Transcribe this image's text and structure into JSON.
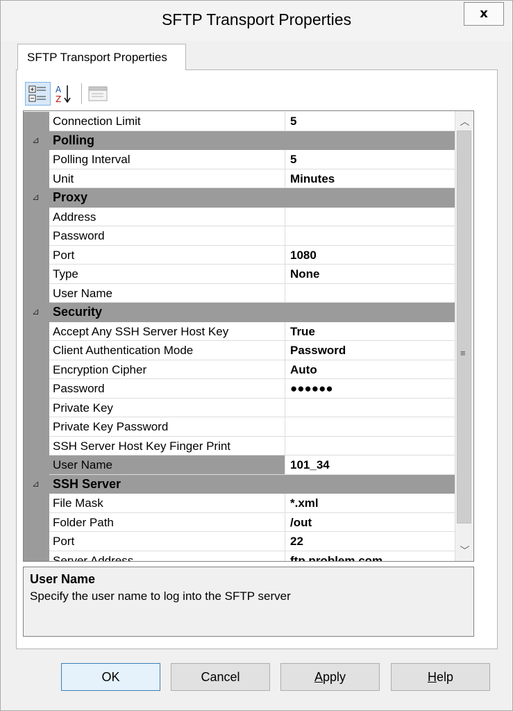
{
  "window": {
    "title": "SFTP Transport Properties",
    "close_glyph": "x"
  },
  "tab": {
    "label": "SFTP Transport Properties"
  },
  "toolbar": {
    "categorized_icon": "categorized-view-icon",
    "alphabetical_icon": "sort-alphabetical-icon",
    "property_pages_icon": "property-pages-icon"
  },
  "grid": {
    "rows": [
      {
        "kind": "prop",
        "name": "Connection Limit",
        "value": "5"
      },
      {
        "kind": "cat",
        "name": "Polling",
        "toggle": "⊿"
      },
      {
        "kind": "prop",
        "name": "Polling Interval",
        "value": "5"
      },
      {
        "kind": "prop",
        "name": "Unit",
        "value": "Minutes"
      },
      {
        "kind": "cat",
        "name": "Proxy",
        "toggle": "⊿"
      },
      {
        "kind": "prop",
        "name": "Address",
        "value": ""
      },
      {
        "kind": "prop",
        "name": "Password",
        "value": ""
      },
      {
        "kind": "prop",
        "name": "Port",
        "value": "1080"
      },
      {
        "kind": "prop",
        "name": "Type",
        "value": "None"
      },
      {
        "kind": "prop",
        "name": "User Name",
        "value": ""
      },
      {
        "kind": "cat",
        "name": "Security",
        "toggle": "⊿"
      },
      {
        "kind": "prop",
        "name": "Accept Any SSH Server Host Key",
        "value": "True"
      },
      {
        "kind": "prop",
        "name": "Client Authentication Mode",
        "value": "Password"
      },
      {
        "kind": "prop",
        "name": "Encryption Cipher",
        "value": "Auto"
      },
      {
        "kind": "prop",
        "name": "Password",
        "value": "●●●●●●"
      },
      {
        "kind": "prop",
        "name": "Private Key",
        "value": ""
      },
      {
        "kind": "prop",
        "name": "Private Key Password",
        "value": ""
      },
      {
        "kind": "prop",
        "name": "SSH Server Host Key Finger Print",
        "value": ""
      },
      {
        "kind": "prop",
        "name": "User Name",
        "value": "101_34",
        "selected": true
      },
      {
        "kind": "cat",
        "name": "SSH Server",
        "toggle": "⊿"
      },
      {
        "kind": "prop",
        "name": "File Mask",
        "value": "*.xml"
      },
      {
        "kind": "prop",
        "name": "Folder Path",
        "value": "/out"
      },
      {
        "kind": "prop",
        "name": "Port",
        "value": "22"
      },
      {
        "kind": "prop",
        "name": "Server Address",
        "value": "ftp.problem.com"
      }
    ],
    "scroll": {
      "up_glyph": "︿",
      "down_glyph": "﹀",
      "grip_glyph": "≡"
    }
  },
  "help": {
    "title": "User Name",
    "description": "Specify the user name to log into the SFTP server"
  },
  "buttons": {
    "ok": "OK",
    "cancel": "Cancel",
    "apply_mnemonic": "A",
    "apply_rest": "pply",
    "help_mnemonic": "H",
    "help_rest": "elp"
  }
}
